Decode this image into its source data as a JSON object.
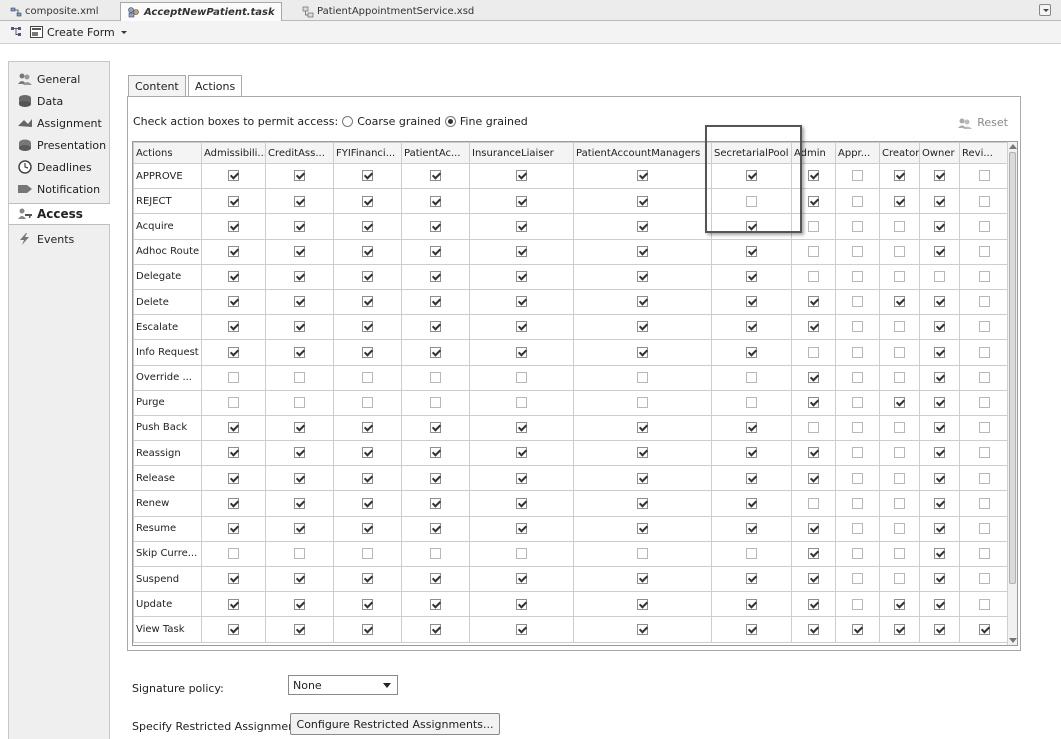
{
  "editor_tabs": [
    {
      "label": "composite.xml"
    },
    {
      "label": "AcceptNewPatient.task"
    },
    {
      "label": "PatientAppointmentService.xsd"
    }
  ],
  "toolbar": {
    "create_form_label": "Create Form"
  },
  "sidebar": {
    "items": [
      {
        "label": "General"
      },
      {
        "label": "Data"
      },
      {
        "label": "Assignment"
      },
      {
        "label": "Presentation"
      },
      {
        "label": "Deadlines"
      },
      {
        "label": "Notification"
      },
      {
        "label": "Access"
      },
      {
        "label": "Events"
      }
    ],
    "active_index": 6
  },
  "subtabs": [
    {
      "label": "Content"
    },
    {
      "label": "Actions"
    }
  ],
  "access": {
    "prompt": "Check action boxes to permit access:",
    "coarse_label": "Coarse grained",
    "fine_label": "Fine grained",
    "selected": "fine",
    "reset_label": "Reset"
  },
  "grid": {
    "columns": [
      "Actions",
      "Admissibili...",
      "CreditAss...",
      "FYIFinanci...",
      "PatientAc...",
      "InsuranceLiaiser",
      "PatientAccountManagers",
      "SecretarialPool",
      "Admin",
      "Appr...",
      "Creator",
      "Owner",
      "Revi..."
    ],
    "rows": [
      {
        "action": "APPROVE",
        "checks": [
          1,
          1,
          1,
          1,
          1,
          1,
          1,
          1,
          0,
          1,
          1,
          0
        ]
      },
      {
        "action": "REJECT",
        "checks": [
          1,
          1,
          1,
          1,
          1,
          1,
          0,
          1,
          0,
          1,
          1,
          0
        ]
      },
      {
        "action": "Acquire",
        "checks": [
          1,
          1,
          1,
          1,
          1,
          1,
          1,
          0,
          0,
          0,
          1,
          0
        ]
      },
      {
        "action": "Adhoc Route",
        "checks": [
          1,
          1,
          1,
          1,
          1,
          1,
          1,
          0,
          0,
          0,
          1,
          0
        ]
      },
      {
        "action": "Delegate",
        "checks": [
          1,
          1,
          1,
          1,
          1,
          1,
          1,
          0,
          0,
          0,
          0,
          0
        ]
      },
      {
        "action": "Delete",
        "checks": [
          1,
          1,
          1,
          1,
          1,
          1,
          1,
          1,
          0,
          1,
          1,
          0
        ]
      },
      {
        "action": "Escalate",
        "checks": [
          1,
          1,
          1,
          1,
          1,
          1,
          1,
          1,
          0,
          0,
          1,
          0
        ]
      },
      {
        "action": "Info Request",
        "checks": [
          1,
          1,
          1,
          1,
          1,
          1,
          1,
          0,
          0,
          0,
          1,
          0
        ]
      },
      {
        "action": "Override ...",
        "checks": [
          0,
          0,
          0,
          0,
          0,
          0,
          0,
          1,
          0,
          0,
          1,
          0
        ]
      },
      {
        "action": "Purge",
        "checks": [
          0,
          0,
          0,
          0,
          0,
          0,
          0,
          1,
          0,
          1,
          1,
          0
        ]
      },
      {
        "action": "Push Back",
        "checks": [
          1,
          1,
          1,
          1,
          1,
          1,
          1,
          0,
          0,
          0,
          1,
          0
        ]
      },
      {
        "action": "Reassign",
        "checks": [
          1,
          1,
          1,
          1,
          1,
          1,
          1,
          1,
          0,
          0,
          1,
          0
        ]
      },
      {
        "action": "Release",
        "checks": [
          1,
          1,
          1,
          1,
          1,
          1,
          1,
          1,
          0,
          0,
          1,
          0
        ]
      },
      {
        "action": "Renew",
        "checks": [
          1,
          1,
          1,
          1,
          1,
          1,
          1,
          0,
          0,
          0,
          1,
          0
        ]
      },
      {
        "action": "Resume",
        "checks": [
          1,
          1,
          1,
          1,
          1,
          1,
          1,
          1,
          0,
          0,
          1,
          0
        ]
      },
      {
        "action": "Skip Curre...",
        "checks": [
          0,
          0,
          0,
          0,
          0,
          0,
          0,
          1,
          0,
          0,
          1,
          0
        ]
      },
      {
        "action": "Suspend",
        "checks": [
          1,
          1,
          1,
          1,
          1,
          1,
          1,
          1,
          0,
          0,
          1,
          0
        ]
      },
      {
        "action": "Update",
        "checks": [
          1,
          1,
          1,
          1,
          1,
          1,
          1,
          1,
          0,
          1,
          1,
          0
        ]
      },
      {
        "action": "View Task",
        "checks": [
          1,
          1,
          1,
          1,
          1,
          1,
          1,
          1,
          1,
          1,
          1,
          1
        ]
      }
    ]
  },
  "signature": {
    "label": "Signature policy:",
    "value": "None"
  },
  "restricted": {
    "label": "Specify Restricted Assignment",
    "button_label": "Configure Restricted Assignments..."
  }
}
